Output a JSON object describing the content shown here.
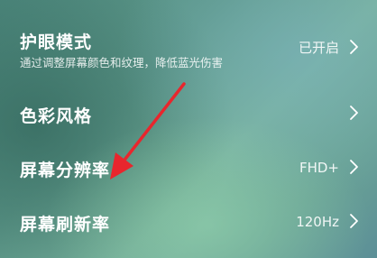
{
  "settings": {
    "items": [
      {
        "label": "护眼模式",
        "description": "通过调整屏幕颜色和纹理，降低蓝光伤害",
        "value": "已开启"
      },
      {
        "label": "色彩风格",
        "value": ""
      },
      {
        "label": "屏幕分辨率",
        "value": "FHD+"
      },
      {
        "label": "屏幕刷新率",
        "value": "120Hz"
      }
    ]
  },
  "annotation": {
    "icon": "red-arrow-icon",
    "color": "#e8262d"
  },
  "icons": {
    "chevron": "chevron-right-icon"
  }
}
